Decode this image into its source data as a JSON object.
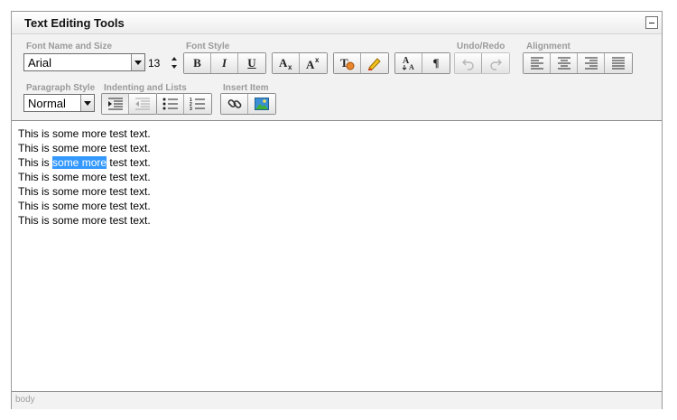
{
  "panel": {
    "title": "Text Editing Tools"
  },
  "groups": {
    "font_name_size": "Font Name and Size",
    "font_style": "Font Style",
    "undo_redo": "Undo/Redo",
    "alignment": "Alignment",
    "paragraph_style": "Paragraph Style",
    "indenting_lists": "Indenting and Lists",
    "insert_item": "Insert Item"
  },
  "font": {
    "name": "Arial",
    "size": "13"
  },
  "paragraph": {
    "style": "Normal"
  },
  "buttons": {
    "bold": "B",
    "italic": "I",
    "underline": "U",
    "pilcrow": "¶"
  },
  "editor": {
    "lines": [
      {
        "text": "This is some more test text."
      },
      {
        "text": "This is some more test text."
      },
      {
        "before": "This is ",
        "selected": "some more",
        "after": " test text."
      },
      {
        "text": "This is some more test text."
      },
      {
        "text": "This is some more test text."
      },
      {
        "text": "This is some more test text."
      },
      {
        "text": "This is some more test text."
      }
    ]
  },
  "status": {
    "path": "body"
  },
  "colors": {
    "selection": "#3399ff",
    "panel_bg": "#f2f2f2",
    "label": "#9a9a9a"
  },
  "icons": [
    "collapse-icon",
    "subscript-icon",
    "superscript-icon",
    "clear-format-icon",
    "highlight-icon",
    "font-size-icon",
    "pilcrow-icon",
    "undo-icon",
    "redo-icon",
    "align-left-icon",
    "align-center-icon",
    "align-right-icon",
    "align-justify-icon",
    "indent-icon",
    "outdent-icon",
    "bulleted-list-icon",
    "numbered-list-icon",
    "link-icon",
    "image-icon"
  ]
}
